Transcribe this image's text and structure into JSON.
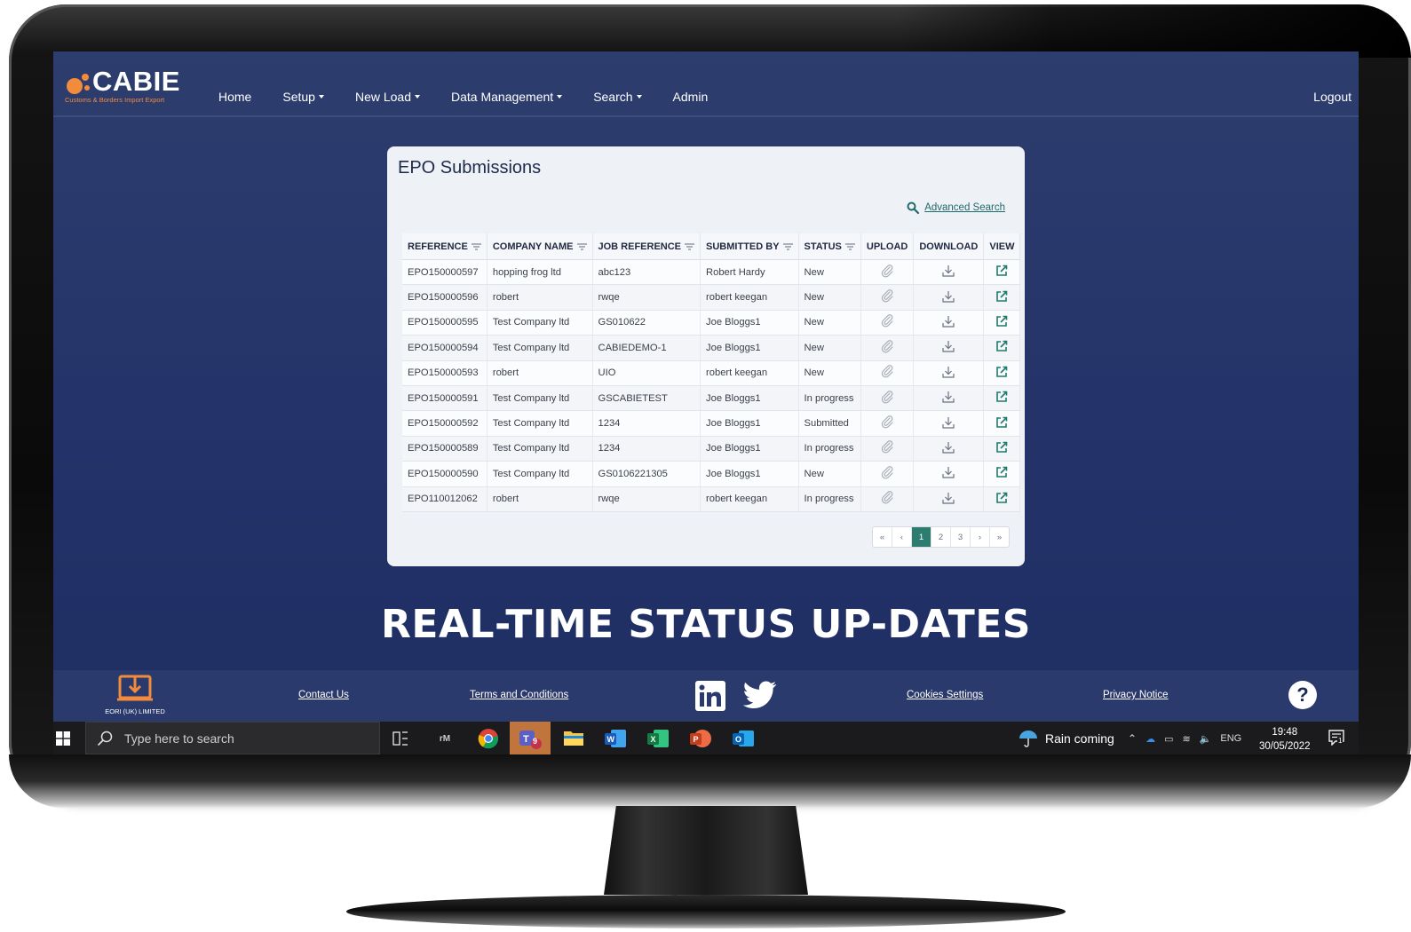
{
  "app": {
    "logo_text": "CABIE",
    "logo_tagline": "Customs & Borders Import Export",
    "accent": "#f28b3c"
  },
  "nav": {
    "items": [
      {
        "label": "Home",
        "dropdown": false
      },
      {
        "label": "Setup",
        "dropdown": true
      },
      {
        "label": "New Load",
        "dropdown": true
      },
      {
        "label": "Data Management",
        "dropdown": true
      },
      {
        "label": "Search",
        "dropdown": true
      },
      {
        "label": "Admin",
        "dropdown": false
      }
    ],
    "logout": "Logout"
  },
  "card": {
    "title": "EPO Submissions",
    "advanced_search": "Advanced Search"
  },
  "table": {
    "columns": [
      "REFERENCE",
      "COMPANY NAME",
      "JOB REFERENCE",
      "SUBMITTED BY",
      "STATUS",
      "UPLOAD",
      "DOWNLOAD",
      "VIEW"
    ],
    "rows": [
      {
        "reference": "EPO150000597",
        "company": "hopping frog ltd",
        "job": "abc123",
        "submitted_by": "Robert Hardy",
        "status": "New"
      },
      {
        "reference": "EPO150000596",
        "company": "robert",
        "job": "rwqe",
        "submitted_by": "robert keegan",
        "status": "New"
      },
      {
        "reference": "EPO150000595",
        "company": "Test Company ltd",
        "job": "GS010622",
        "submitted_by": "Joe Bloggs1",
        "status": "New"
      },
      {
        "reference": "EPO150000594",
        "company": "Test Company ltd",
        "job": "CABIEDEMO-1",
        "submitted_by": "Joe Bloggs1",
        "status": "New"
      },
      {
        "reference": "EPO150000593",
        "company": "robert",
        "job": "UIO",
        "submitted_by": "robert keegan",
        "status": "New"
      },
      {
        "reference": "EPO150000591",
        "company": "Test Company ltd",
        "job": "GSCABIETEST",
        "submitted_by": "Joe Bloggs1",
        "status": "In progress"
      },
      {
        "reference": "EPO150000592",
        "company": "Test Company ltd",
        "job": "1234",
        "submitted_by": "Joe Bloggs1",
        "status": "Submitted"
      },
      {
        "reference": "EPO150000589",
        "company": "Test Company ltd",
        "job": "1234",
        "submitted_by": "Joe Bloggs1",
        "status": "In progress"
      },
      {
        "reference": "EPO150000590",
        "company": "Test Company ltd",
        "job": "GS0106221305",
        "submitted_by": "Joe Bloggs1",
        "status": "New"
      },
      {
        "reference": "EPO110012062",
        "company": "robert",
        "job": "rwqe",
        "submitted_by": "robert keegan",
        "status": "In progress"
      }
    ]
  },
  "pagination": {
    "items": [
      "«",
      "‹",
      "1",
      "2",
      "3",
      "›",
      "»"
    ],
    "active": "1",
    "active_color": "#2c7d6f"
  },
  "headline": "REAL-TIME STATUS UP-DATES",
  "footer": {
    "eori_label": "EORI (UK) LIMITED",
    "contact": "Contact Us",
    "terms": "Terms and Conditions",
    "cookies": "Cookies Settings",
    "privacy": "Privacy Notice",
    "help": "?"
  },
  "taskbar": {
    "search_placeholder": "Type here to search",
    "weather": "Rain coming",
    "language": "ENG",
    "time": "19:48",
    "date": "30/05/2022",
    "notification_count": "1",
    "teams_badge": "9"
  }
}
